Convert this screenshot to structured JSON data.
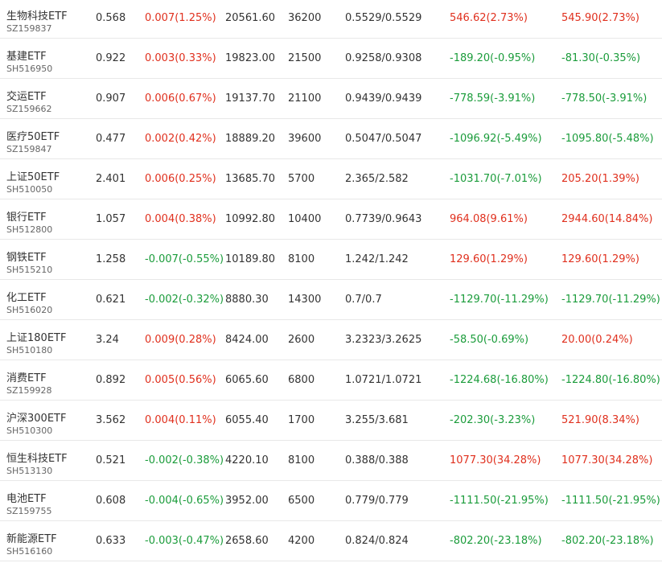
{
  "colors": {
    "up": "#e0301e",
    "down": "#1b9c3b",
    "text": "#333333",
    "code": "#666666",
    "divider": "#e8e8e8"
  },
  "rows": [
    {
      "name": "生物科技ETF",
      "code": "SZ159837",
      "price": "0.568",
      "change": "0.007(1.25%)",
      "change_dir": "up",
      "amount": "20561.60",
      "volume": "36200",
      "nav": "0.5529/0.5529",
      "pl1": "546.62(2.73%)",
      "pl1_dir": "up",
      "pl2": "545.90(2.73%)",
      "pl2_dir": "up"
    },
    {
      "name": "基建ETF",
      "code": "SH516950",
      "price": "0.922",
      "change": "0.003(0.33%)",
      "change_dir": "up",
      "amount": "19823.00",
      "volume": "21500",
      "nav": "0.9258/0.9308",
      "pl1": "-189.20(-0.95%)",
      "pl1_dir": "down",
      "pl2": "-81.30(-0.35%)",
      "pl2_dir": "down"
    },
    {
      "name": "交运ETF",
      "code": "SZ159662",
      "price": "0.907",
      "change": "0.006(0.67%)",
      "change_dir": "up",
      "amount": "19137.70",
      "volume": "21100",
      "nav": "0.9439/0.9439",
      "pl1": "-778.59(-3.91%)",
      "pl1_dir": "down",
      "pl2": "-778.50(-3.91%)",
      "pl2_dir": "down"
    },
    {
      "name": "医疗50ETF",
      "code": "SZ159847",
      "price": "0.477",
      "change": "0.002(0.42%)",
      "change_dir": "up",
      "amount": "18889.20",
      "volume": "39600",
      "nav": "0.5047/0.5047",
      "pl1": "-1096.92(-5.49%)",
      "pl1_dir": "down",
      "pl2": "-1095.80(-5.48%)",
      "pl2_dir": "down"
    },
    {
      "name": "上证50ETF",
      "code": "SH510050",
      "price": "2.401",
      "change": "0.006(0.25%)",
      "change_dir": "up",
      "amount": "13685.70",
      "volume": "5700",
      "nav": "2.365/2.582",
      "pl1": "-1031.70(-7.01%)",
      "pl1_dir": "down",
      "pl2": "205.20(1.39%)",
      "pl2_dir": "up"
    },
    {
      "name": "银行ETF",
      "code": "SH512800",
      "price": "1.057",
      "change": "0.004(0.38%)",
      "change_dir": "up",
      "amount": "10992.80",
      "volume": "10400",
      "nav": "0.7739/0.9643",
      "pl1": "964.08(9.61%)",
      "pl1_dir": "up",
      "pl2": "2944.60(14.84%)",
      "pl2_dir": "up"
    },
    {
      "name": "钢铁ETF",
      "code": "SH515210",
      "price": "1.258",
      "change": "-0.007(-0.55%)",
      "change_dir": "down",
      "amount": "10189.80",
      "volume": "8100",
      "nav": "1.242/1.242",
      "pl1": "129.60(1.29%)",
      "pl1_dir": "up",
      "pl2": "129.60(1.29%)",
      "pl2_dir": "up"
    },
    {
      "name": "化工ETF",
      "code": "SH516020",
      "price": "0.621",
      "change": "-0.002(-0.32%)",
      "change_dir": "down",
      "amount": "8880.30",
      "volume": "14300",
      "nav": "0.7/0.7",
      "pl1": "-1129.70(-11.29%)",
      "pl1_dir": "down",
      "pl2": "-1129.70(-11.29%)",
      "pl2_dir": "down"
    },
    {
      "name": "上证180ETF",
      "code": "SH510180",
      "price": "3.24",
      "change": "0.009(0.28%)",
      "change_dir": "up",
      "amount": "8424.00",
      "volume": "2600",
      "nav": "3.2323/3.2625",
      "pl1": "-58.50(-0.69%)",
      "pl1_dir": "down",
      "pl2": "20.00(0.24%)",
      "pl2_dir": "up"
    },
    {
      "name": "消费ETF",
      "code": "SZ159928",
      "price": "0.892",
      "change": "0.005(0.56%)",
      "change_dir": "up",
      "amount": "6065.60",
      "volume": "6800",
      "nav": "1.0721/1.0721",
      "pl1": "-1224.68(-16.80%)",
      "pl1_dir": "down",
      "pl2": "-1224.80(-16.80%)",
      "pl2_dir": "down"
    },
    {
      "name": "沪深300ETF",
      "code": "SH510300",
      "price": "3.562",
      "change": "0.004(0.11%)",
      "change_dir": "up",
      "amount": "6055.40",
      "volume": "1700",
      "nav": "3.255/3.681",
      "pl1": "-202.30(-3.23%)",
      "pl1_dir": "down",
      "pl2": "521.90(8.34%)",
      "pl2_dir": "up"
    },
    {
      "name": "恒生科技ETF",
      "code": "SH513130",
      "price": "0.521",
      "change": "-0.002(-0.38%)",
      "change_dir": "down",
      "amount": "4220.10",
      "volume": "8100",
      "nav": "0.388/0.388",
      "pl1": "1077.30(34.28%)",
      "pl1_dir": "up",
      "pl2": "1077.30(34.28%)",
      "pl2_dir": "up"
    },
    {
      "name": "电池ETF",
      "code": "SZ159755",
      "price": "0.608",
      "change": "-0.004(-0.65%)",
      "change_dir": "down",
      "amount": "3952.00",
      "volume": "6500",
      "nav": "0.779/0.779",
      "pl1": "-1111.50(-21.95%)",
      "pl1_dir": "down",
      "pl2": "-1111.50(-21.95%)",
      "pl2_dir": "down"
    },
    {
      "name": "新能源ETF",
      "code": "SH516160",
      "price": "0.633",
      "change": "-0.003(-0.47%)",
      "change_dir": "down",
      "amount": "2658.60",
      "volume": "4200",
      "nav": "0.824/0.824",
      "pl1": "-802.20(-23.18%)",
      "pl1_dir": "down",
      "pl2": "-802.20(-23.18%)",
      "pl2_dir": "down"
    }
  ]
}
